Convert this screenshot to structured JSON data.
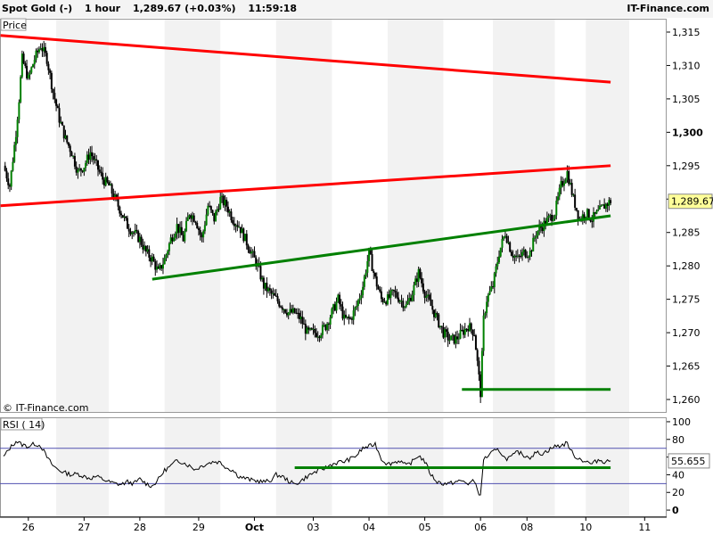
{
  "header": {
    "instrument": "Spot Gold (-)",
    "interval": "1 hour",
    "quote": "1,289.67 (+0.03%)",
    "time": "11:59:18",
    "brand": "IT-Finance.com"
  },
  "colors": {
    "up_candle": "#008000",
    "down_candle": "#000000",
    "resistance_line": "#ff0000",
    "support_line": "#008000",
    "rsi_line": "#000000",
    "rsi_band": "#5050b0",
    "price_label_bg": "#ffff99",
    "weekend_shade": "#f2f2f2"
  },
  "chart_data": [
    {
      "type": "candlestick",
      "panel_label": "Price",
      "watermark": "© IT-Finance.com",
      "last_price_label": "1,289.67",
      "ylim": [
        1258,
        1317
      ],
      "y_ticks": [
        1260,
        1265,
        1270,
        1275,
        1280,
        1285,
        1290,
        1295,
        1300,
        1305,
        1310,
        1315
      ],
      "y_tick_labels": [
        "1,260",
        "1,265",
        "1,270",
        "1,275",
        "1,280",
        "1,285",
        "1,290",
        "1,295",
        "1,300",
        "1,305",
        "1,310",
        "1,315"
      ],
      "major_tick": 1300,
      "price_path": [
        [
          0,
          1295
        ],
        [
          1,
          1292
        ],
        [
          1.5,
          1296
        ],
        [
          2,
          1300
        ],
        [
          2.5,
          1305
        ],
        [
          3,
          1311
        ],
        [
          4,
          1308
        ],
        [
          5,
          1311
        ],
        [
          6,
          1313
        ],
        [
          7,
          1311
        ],
        [
          8,
          1306
        ],
        [
          9,
          1302
        ],
        [
          10,
          1299
        ],
        [
          11,
          1297
        ],
        [
          12,
          1294
        ],
        [
          13,
          1295
        ],
        [
          14,
          1297
        ],
        [
          15,
          1295
        ],
        [
          16,
          1293
        ],
        [
          17,
          1292
        ],
        [
          18,
          1290
        ],
        [
          19,
          1288
        ],
        [
          20,
          1286
        ],
        [
          21,
          1285
        ],
        [
          22,
          1284
        ],
        [
          23,
          1282
        ],
        [
          24,
          1281
        ],
        [
          25,
          1279
        ],
        [
          26,
          1281
        ],
        [
          27,
          1284
        ],
        [
          28,
          1286
        ],
        [
          29,
          1284
        ],
        [
          30,
          1288
        ],
        [
          31,
          1287
        ],
        [
          32,
          1284
        ],
        [
          33,
          1289
        ],
        [
          34,
          1287
        ],
        [
          35,
          1290
        ],
        [
          36,
          1289
        ],
        [
          37,
          1287
        ],
        [
          38,
          1286
        ],
        [
          39,
          1284
        ],
        [
          40,
          1282
        ],
        [
          41,
          1280
        ],
        [
          42,
          1277
        ],
        [
          43,
          1276
        ],
        [
          44,
          1275
        ],
        [
          45,
          1274
        ],
        [
          46,
          1273
        ],
        [
          47,
          1273
        ],
        [
          48,
          1272
        ],
        [
          49,
          1270
        ],
        [
          50,
          1270
        ],
        [
          51,
          1270
        ],
        [
          52,
          1271
        ],
        [
          53,
          1273
        ],
        [
          54,
          1275
        ],
        [
          55,
          1272
        ],
        [
          56,
          1272
        ],
        [
          57,
          1274
        ],
        [
          58,
          1277
        ],
        [
          59,
          1282
        ],
        [
          60,
          1278
        ],
        [
          61,
          1275
        ],
        [
          62,
          1275
        ],
        [
          63,
          1276
        ],
        [
          64,
          1275
        ],
        [
          65,
          1274
        ],
        [
          66,
          1276
        ],
        [
          67,
          1279
        ],
        [
          68,
          1276
        ],
        [
          69,
          1274
        ],
        [
          70,
          1272
        ],
        [
          71,
          1270
        ],
        [
          72,
          1269
        ],
        [
          73,
          1269
        ],
        [
          74,
          1270
        ],
        [
          75,
          1271
        ],
        [
          76,
          1270
        ],
        [
          77,
          1261
        ],
        [
          77.5,
          1272
        ],
        [
          78,
          1275
        ],
        [
          79,
          1277
        ],
        [
          80,
          1282
        ],
        [
          81,
          1285
        ],
        [
          82,
          1282
        ],
        [
          83,
          1281
        ],
        [
          84,
          1282
        ],
        [
          85,
          1282
        ],
        [
          86,
          1285
        ],
        [
          87,
          1286
        ],
        [
          88,
          1287
        ],
        [
          89,
          1288
        ],
        [
          90,
          1292
        ],
        [
          91,
          1294
        ],
        [
          92,
          1290
        ],
        [
          93,
          1287
        ],
        [
          94,
          1288
        ],
        [
          95,
          1287
        ],
        [
          96,
          1288
        ],
        [
          97,
          1289
        ],
        [
          98,
          1289.7
        ]
      ],
      "trendlines": [
        {
          "color": "resistance",
          "from": [
            -0.5,
            1314.5
          ],
          "to": [
            98,
            1307.5
          ]
        },
        {
          "color": "resistance",
          "from": [
            -0.5,
            1289
          ],
          "to": [
            98,
            1295
          ]
        },
        {
          "color": "support",
          "from": [
            24,
            1278
          ],
          "to": [
            98,
            1287.5
          ]
        },
        {
          "color": "support",
          "from": [
            74,
            1261.5
          ],
          "to": [
            98,
            1261.5
          ]
        }
      ]
    },
    {
      "type": "line",
      "panel_label": "RSI ( 14)",
      "last_value_label": "55.655",
      "ylim": [
        -8,
        105
      ],
      "y_ticks": [
        0,
        20,
        40,
        60,
        80,
        100
      ],
      "y_tick_labels": [
        "0",
        "20",
        "40",
        "60",
        "80",
        "100"
      ],
      "bands": [
        30,
        70
      ],
      "rsi_path": [
        [
          0,
          60
        ],
        [
          1,
          70
        ],
        [
          2,
          78
        ],
        [
          3,
          74
        ],
        [
          4,
          72
        ],
        [
          5,
          75
        ],
        [
          6,
          73
        ],
        [
          7,
          60
        ],
        [
          8,
          50
        ],
        [
          9,
          45
        ],
        [
          10,
          42
        ],
        [
          11,
          40
        ],
        [
          12,
          41
        ],
        [
          13,
          38
        ],
        [
          14,
          36
        ],
        [
          15,
          38
        ],
        [
          16,
          35
        ],
        [
          17,
          32
        ],
        [
          18,
          30
        ],
        [
          19,
          29
        ],
        [
          20,
          32
        ],
        [
          21,
          30
        ],
        [
          22,
          35
        ],
        [
          23,
          30
        ],
        [
          24,
          27
        ],
        [
          25,
          35
        ],
        [
          26,
          45
        ],
        [
          27,
          50
        ],
        [
          28,
          56
        ],
        [
          29,
          54
        ],
        [
          30,
          50
        ],
        [
          31,
          46
        ],
        [
          32,
          50
        ],
        [
          33,
          53
        ],
        [
          34,
          55
        ],
        [
          35,
          54
        ],
        [
          36,
          48
        ],
        [
          37,
          45
        ],
        [
          38,
          38
        ],
        [
          39,
          36
        ],
        [
          40,
          34
        ],
        [
          41,
          33
        ],
        [
          42,
          32
        ],
        [
          43,
          33
        ],
        [
          44,
          40
        ],
        [
          45,
          38
        ],
        [
          46,
          33
        ],
        [
          47,
          29
        ],
        [
          48,
          33
        ],
        [
          49,
          38
        ],
        [
          50,
          42
        ],
        [
          51,
          45
        ],
        [
          52,
          48
        ],
        [
          53,
          52
        ],
        [
          54,
          54
        ],
        [
          55,
          55
        ],
        [
          56,
          58
        ],
        [
          57,
          62
        ],
        [
          58,
          70
        ],
        [
          59,
          72
        ],
        [
          60,
          75
        ],
        [
          61,
          58
        ],
        [
          62,
          52
        ],
        [
          63,
          54
        ],
        [
          64,
          56
        ],
        [
          65,
          50
        ],
        [
          66,
          55
        ],
        [
          67,
          62
        ],
        [
          68,
          55
        ],
        [
          69,
          40
        ],
        [
          70,
          32
        ],
        [
          71,
          30
        ],
        [
          72,
          30
        ],
        [
          73,
          32
        ],
        [
          74,
          33
        ],
        [
          75,
          30
        ],
        [
          76,
          33
        ],
        [
          77,
          15
        ],
        [
          77.5,
          58
        ],
        [
          78,
          60
        ],
        [
          79,
          66
        ],
        [
          80,
          68
        ],
        [
          81,
          58
        ],
        [
          82,
          60
        ],
        [
          83,
          66
        ],
        [
          84,
          62
        ],
        [
          85,
          60
        ],
        [
          86,
          65
        ],
        [
          87,
          64
        ],
        [
          88,
          68
        ],
        [
          89,
          72
        ],
        [
          90,
          73
        ],
        [
          91,
          76
        ],
        [
          92,
          62
        ],
        [
          93,
          58
        ],
        [
          94,
          55
        ],
        [
          95,
          52
        ],
        [
          96,
          57
        ],
        [
          97,
          55
        ],
        [
          98,
          55.655
        ]
      ],
      "support_line": {
        "from": [
          47,
          48
        ],
        "to": [
          98,
          48
        ]
      }
    }
  ],
  "x_axis": {
    "categories": [
      "26",
      "27",
      "28",
      "29",
      "Oct",
      "03",
      "04",
      "05",
      "06",
      "08",
      "10",
      "11"
    ],
    "positions": [
      4,
      13,
      22,
      31.5,
      40.5,
      50,
      59,
      68,
      77,
      84.5,
      94,
      103.5
    ],
    "shaded_days": [
      [
        8.5,
        17
      ],
      [
        26,
        35
      ],
      [
        44,
        53
      ],
      [
        62,
        71
      ],
      [
        79,
        89
      ],
      [
        94,
        101
      ]
    ]
  }
}
